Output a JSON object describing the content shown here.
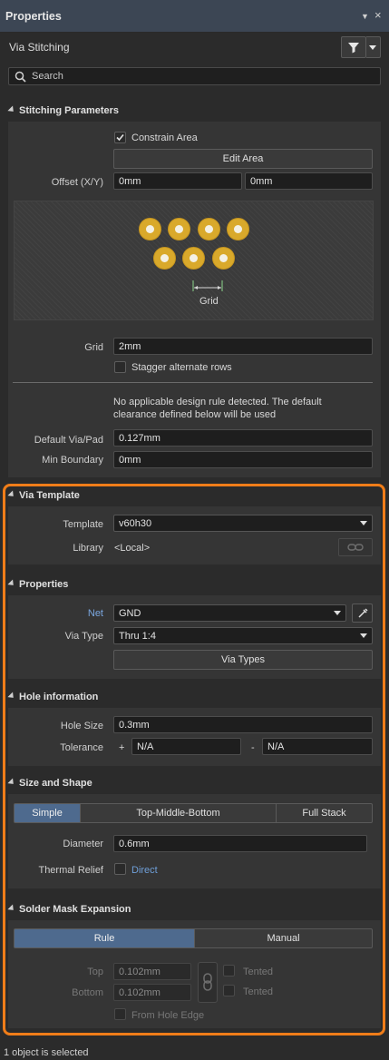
{
  "panel": {
    "title": "Properties",
    "pin_icon": "▼",
    "close_icon": "×"
  },
  "mode": "Via Stitching",
  "search": {
    "placeholder": "Search"
  },
  "stitching": {
    "header": "Stitching Parameters",
    "constrain_area": "Constrain Area",
    "edit_area": "Edit Area",
    "offset_label": "Offset (X/Y)",
    "offset_x": "0mm",
    "offset_y": "0mm",
    "grid_caption": "Grid",
    "grid_label": "Grid",
    "grid_value": "2mm",
    "stagger": "Stagger alternate rows",
    "note": "No applicable design rule detected. The default clearance defined below will be used",
    "default_via_label": "Default Via/Pad",
    "default_via_value": "0.127mm",
    "min_boundary_label": "Min Boundary",
    "min_boundary_value": "0mm"
  },
  "via_template": {
    "header": "Via Template",
    "template_label": "Template",
    "template_value": "v60h30",
    "library_label": "Library",
    "library_value": "<Local>"
  },
  "properties": {
    "header": "Properties",
    "net_label": "Net",
    "net_value": "GND",
    "via_type_label": "Via Type",
    "via_type_value": "Thru 1:4",
    "via_types_button": "Via Types"
  },
  "hole": {
    "header": "Hole information",
    "hole_size_label": "Hole Size",
    "hole_size_value": "0.3mm",
    "tolerance_label": "Tolerance",
    "plus": "+",
    "minus": "-",
    "tol_plus": "N/A",
    "tol_minus": "N/A"
  },
  "size_shape": {
    "header": "Size and Shape",
    "tabs": [
      "Simple",
      "Top-Middle-Bottom",
      "Full Stack"
    ],
    "diameter_label": "Diameter",
    "diameter_value": "0.6mm",
    "thermal_label": "Thermal Relief",
    "thermal_value": "Direct"
  },
  "solder_mask": {
    "header": "Solder Mask Expansion",
    "tabs": [
      "Rule",
      "Manual"
    ],
    "top_label": "Top",
    "top_value": "0.102mm",
    "bottom_label": "Bottom",
    "bottom_value": "0.102mm",
    "tented": "Tented",
    "from_hole": "From Hole Edge"
  },
  "status": "1 object is selected",
  "colors": {
    "accent": "#f07d19",
    "selected_tab": "#4e6a8e",
    "via": "#d9a92b",
    "link": "#6f9fd8"
  }
}
